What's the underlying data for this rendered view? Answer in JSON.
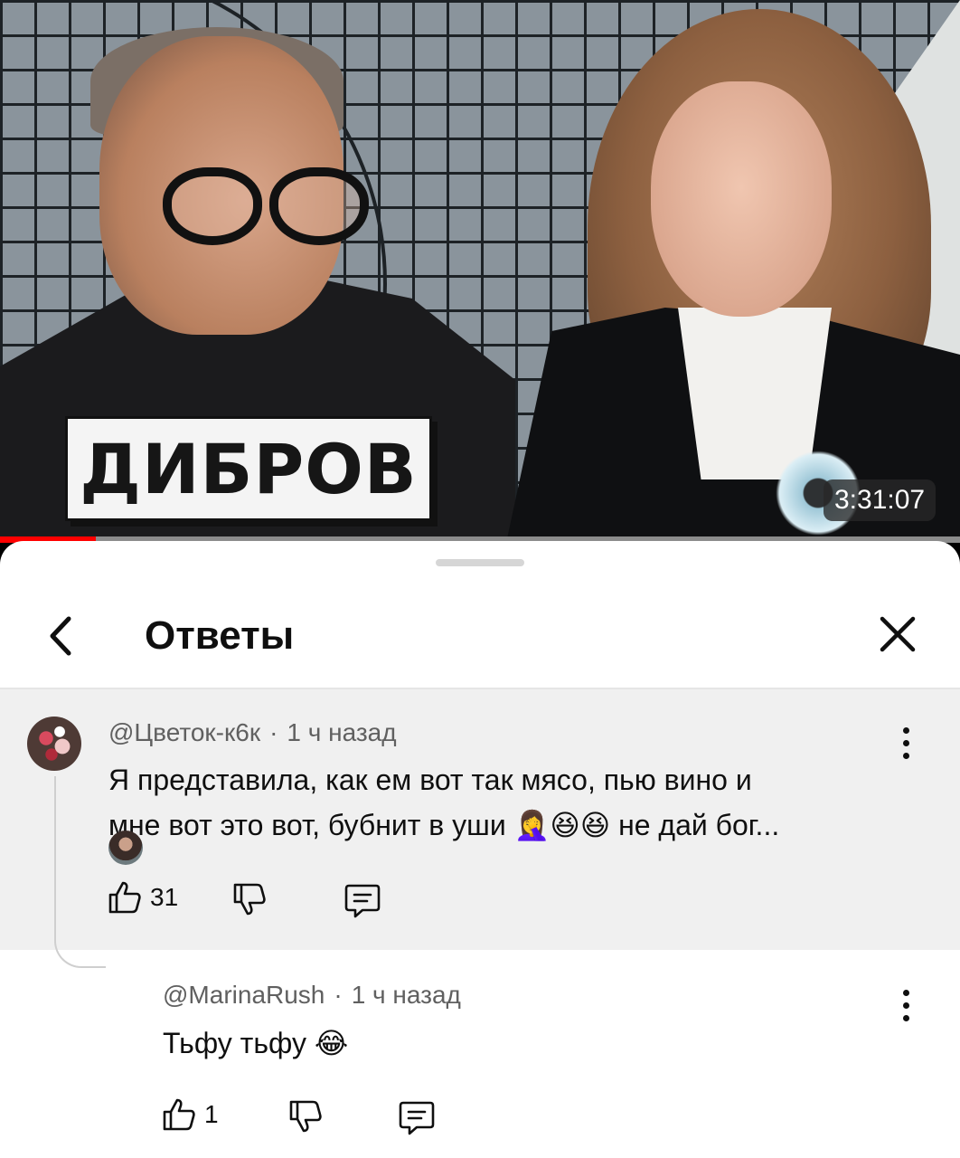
{
  "video": {
    "overlay_title": "ДИБРОВ",
    "duration": "3:31:07",
    "progress_fraction": 0.1,
    "accent_color": "#ff0000"
  },
  "sheet": {
    "title": "Ответы",
    "back_icon": "chevron-left-icon",
    "close_icon": "close-icon"
  },
  "comments": [
    {
      "author": "@Цветок-к6к",
      "time": "1 ч назад",
      "line1": "Я представила,  как  ем вот так мясо,  пью вино и",
      "line2_text": "мне вот это вот, бубнит в уши",
      "line2_emoji": "🤦‍♀️😆😆",
      "line2_tail": " не дай бог...",
      "likes": "31"
    },
    {
      "author": "@MarinaRush",
      "time": "1 ч назад",
      "text": "Тьфу тьфу",
      "emoji": "😂",
      "likes": "1"
    }
  ]
}
